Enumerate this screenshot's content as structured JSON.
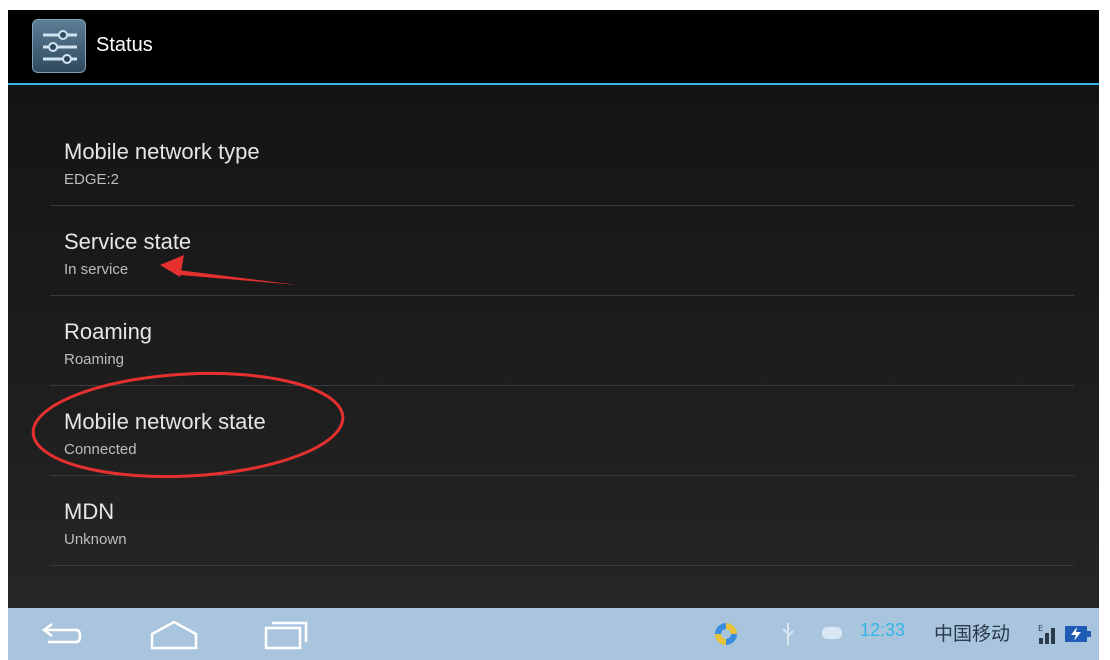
{
  "header": {
    "title": "Status",
    "icon": "settings-sliders-icon"
  },
  "items": [
    {
      "title": "Mobile network type",
      "value": "EDGE:2"
    },
    {
      "title": "Service state",
      "value": "In service"
    },
    {
      "title": "Roaming",
      "value": "Roaming"
    },
    {
      "title": "Mobile network state",
      "value": "Connected"
    },
    {
      "title": "MDN",
      "value": "Unknown"
    }
  ],
  "annotations": {
    "arrow_target": "Service state",
    "circle_target": "Mobile network state",
    "color": "#e53030"
  },
  "navbar": {
    "buttons": [
      "back-icon",
      "home-icon",
      "recent-apps-icon"
    ]
  },
  "statusbar": {
    "clock": "12:33",
    "carrier": "中国移动",
    "icons": [
      "sync-icon",
      "usb-icon",
      "notification-icon",
      "signal-icon",
      "battery-charging-icon"
    ]
  },
  "colors": {
    "accent": "#33b5e5",
    "navbar": "#a9c5de",
    "annotation": "#e53030"
  }
}
